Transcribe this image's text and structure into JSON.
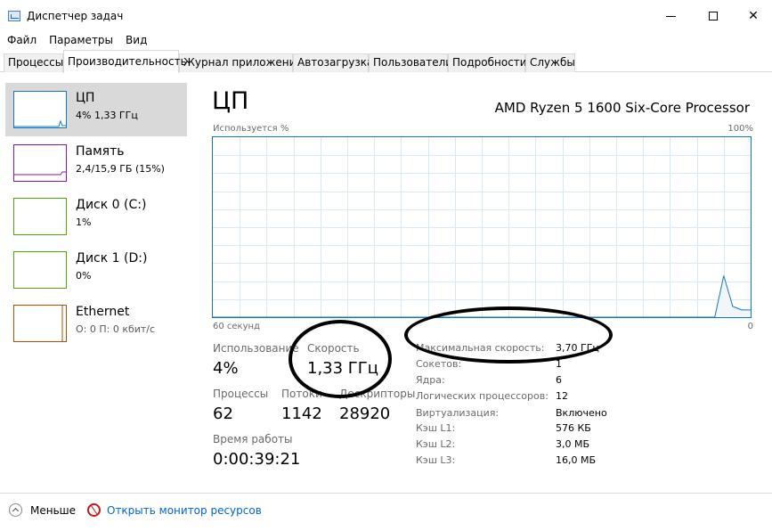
{
  "window": {
    "title": "Диспетчер задач",
    "icon": "task-manager-icon",
    "minimize_icon": "minimize-icon",
    "maximize_icon": "maximize-icon",
    "close_icon": "close-icon",
    "close_glyph": "✕"
  },
  "menu": [
    "Файл",
    "Параметры",
    "Вид"
  ],
  "tabs": [
    {
      "label": "Процессы",
      "active": false
    },
    {
      "label": "Производительность",
      "active": true
    },
    {
      "label": "Журнал приложений",
      "active": false
    },
    {
      "label": "Автозагрузка",
      "active": false
    },
    {
      "label": "Пользователи",
      "active": false
    },
    {
      "label": "Подробности",
      "active": false
    },
    {
      "label": "Службы",
      "active": false
    }
  ],
  "resources": [
    {
      "name": "ЦП",
      "sub": "4% 1,33 ГГц",
      "color": "#1178be",
      "selected": true
    },
    {
      "name": "Память",
      "sub": "2,4/15,9 ГБ (15%)",
      "color": "#8b12ae",
      "selected": false
    },
    {
      "name": "Диск 0 (C:)",
      "sub": "1%",
      "color": "#4da60c",
      "selected": false
    },
    {
      "name": "Диск 1 (D:)",
      "sub": "0%",
      "color": "#4da60c",
      "selected": false
    },
    {
      "name": "Ethernet",
      "sub": "О: 0 П: 0 кбит/с",
      "color": "#a74f01",
      "selected": false
    }
  ],
  "cpu": {
    "title": "ЦП",
    "model": "AMD Ryzen 5 1600 Six-Core Processor",
    "graph": {
      "y_label": "Используется %",
      "y_max_label": "100%",
      "x_label": "60 секунд",
      "x_min_label": "0",
      "line_color": "#1178be",
      "fill_color": "#f1f6fa",
      "usage_percent": [
        0,
        0,
        0,
        0,
        0,
        0,
        0,
        0,
        0,
        0,
        0,
        0,
        0,
        0,
        0,
        0,
        0,
        0,
        0,
        0,
        0,
        0,
        0,
        0,
        0,
        0,
        0,
        0,
        0,
        0,
        0,
        0,
        0,
        0,
        0,
        0,
        0,
        0,
        0,
        0,
        0,
        0,
        0,
        0,
        0,
        0,
        0,
        0,
        0,
        0,
        0,
        0,
        0,
        0,
        0,
        0,
        0,
        23,
        6,
        4,
        4
      ]
    },
    "stats": {
      "usage_label": "Использование",
      "usage_value": "4%",
      "speed_label": "Скорость",
      "speed_value": "1,33 ГГц",
      "processes_label": "Процессы",
      "processes_value": "62",
      "threads_label": "Потоки",
      "threads_value": "1142",
      "handles_label": "Дескрипторы",
      "handles_value": "28920",
      "uptime_label": "Время работы",
      "uptime_value": "0:00:39:21"
    },
    "specs": [
      {
        "label": "Максимальная скорость:",
        "value": "3,70 ГГц"
      },
      {
        "label": "Сокетов:",
        "value": "1"
      },
      {
        "label": "Ядра:",
        "value": "6"
      },
      {
        "label": "Логических процессоров:",
        "value": "12"
      },
      {
        "label": "Виртуализация:",
        "value": "Включено"
      },
      {
        "label": "Кэш L1:",
        "value": "576 КБ"
      },
      {
        "label": "Кэш L2:",
        "value": "3,0 МБ"
      },
      {
        "label": "Кэш L3:",
        "value": "16,0 МБ"
      }
    ]
  },
  "footer": {
    "less_label": "Меньше",
    "monitor_label": "Открыть монитор ресурсов"
  }
}
